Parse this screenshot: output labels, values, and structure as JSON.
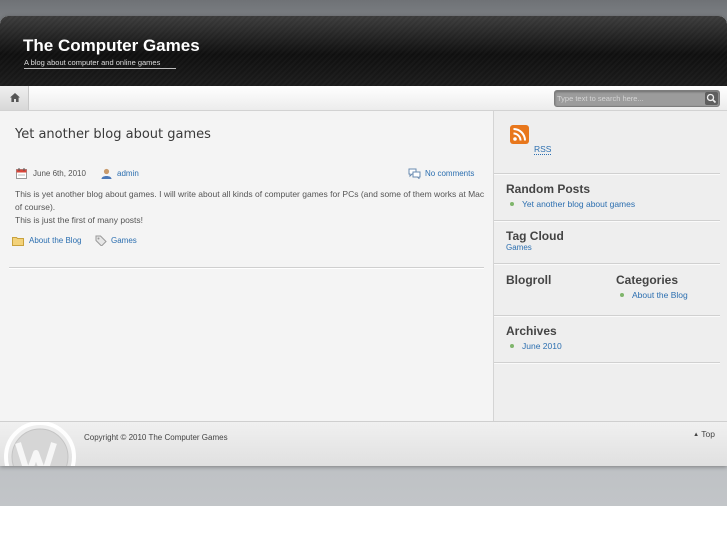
{
  "header": {
    "title": "The Computer Games",
    "description": "A blog about computer and online games"
  },
  "nav": {
    "home_icon": "home-icon",
    "search_placeholder": "Type text to search here...",
    "search_icon": "search-icon"
  },
  "post": {
    "title": "Yet another blog about games",
    "date": "June 6th, 2010",
    "author": "admin",
    "comments": "No comments",
    "body_line1": "This is yet another blog about games. I will write about all kinds of computer games for PCs (and some of them works at Mac of course).",
    "body_line2": "This is just the first of many posts!",
    "category": "About the Blog",
    "tag": "Games"
  },
  "sidebar": {
    "rss_label": "RSS",
    "random_posts": {
      "title": "Random Posts",
      "items": [
        "Yet another blog about games"
      ]
    },
    "tag_cloud": {
      "title": "Tag Cloud",
      "tags": [
        "Games"
      ]
    },
    "blogroll": {
      "title": "Blogroll"
    },
    "categories": {
      "title": "Categories",
      "items": [
        "About the Blog"
      ]
    },
    "archives": {
      "title": "Archives",
      "items": [
        "June 2010"
      ]
    }
  },
  "footer": {
    "copyright": "Copyright © 2010 The Computer Games",
    "top_label": "Top"
  },
  "colors": {
    "link": "#2c6fb0",
    "header_bg": "#1a1a1a",
    "bullet": "#7fb56b",
    "rss": "#e8771c"
  }
}
